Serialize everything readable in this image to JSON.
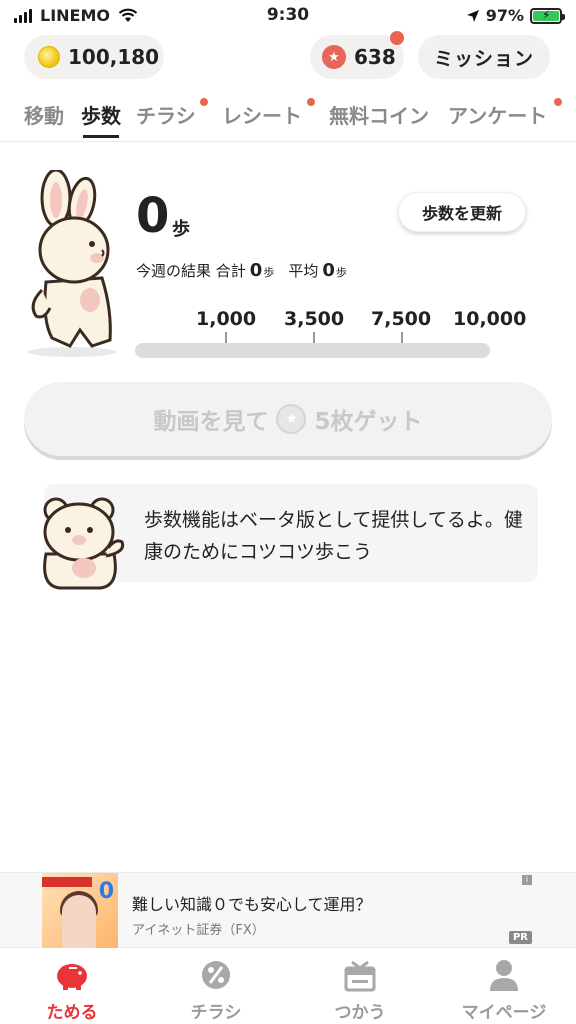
{
  "status_bar": {
    "carrier": "LINEMO",
    "time": "9:30",
    "battery": "97%"
  },
  "header": {
    "coins": "100,180",
    "stars": "638",
    "mission_label": "ミッション"
  },
  "tabs": [
    {
      "label": "移動",
      "active": false,
      "badge": false
    },
    {
      "label": "歩数",
      "active": true,
      "badge": false
    },
    {
      "label": "チラシ",
      "active": false,
      "badge": true
    },
    {
      "label": "レシート",
      "active": false,
      "badge": true
    },
    {
      "label": "無料コイン",
      "active": false,
      "badge": false
    },
    {
      "label": "アンケート",
      "active": false,
      "badge": true
    }
  ],
  "steps": {
    "count": "0",
    "unit": "歩",
    "update_button": "歩数を更新",
    "weekly_label": "今週の結果 合計",
    "weekly_total": "0",
    "weekly_avg_label": "平均",
    "weekly_avg": "0",
    "small_unit": "歩",
    "milestones": [
      "1,000",
      "3,500",
      "7,500",
      "10,000"
    ],
    "progress": 0
  },
  "video_button": {
    "label_before": "動画を見て",
    "label_after": "5枚ゲット"
  },
  "info": {
    "text": "歩数機能はベータ版として提供してるよ。健康のためにコツコツ歩こう"
  },
  "ad": {
    "title": "難しい知識０でも安心して運用？",
    "sponsor": "アイネット証券（FX）",
    "pr_label": "PR",
    "info_label": "i",
    "thumb_text": "0"
  },
  "bottom_nav": [
    {
      "label": "ためる",
      "icon": "piggy-bank-icon",
      "active": true
    },
    {
      "label": "チラシ",
      "icon": "percent-tag-icon",
      "active": false
    },
    {
      "label": "つかう",
      "icon": "gift-box-icon",
      "active": false
    },
    {
      "label": "マイページ",
      "icon": "person-icon",
      "active": false
    }
  ],
  "colors": {
    "accent": "#e8654f",
    "active_nav": "#e8353a"
  }
}
